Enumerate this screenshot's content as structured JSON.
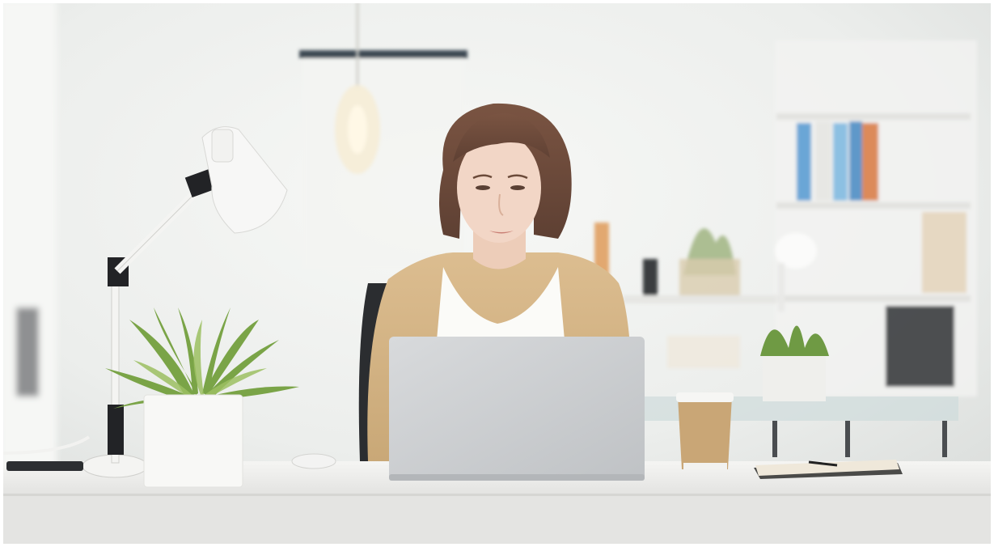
{
  "scene": {
    "kind": "photo",
    "subject": "woman-at-laptop"
  },
  "palette": {
    "wall": "#eef0ee",
    "wall_shadow": "#dfe2df",
    "desk_top": "#f3f3f1",
    "desk_front": "#e8e8e6",
    "laptop": "#cfd1d3",
    "laptop_edge": "#b9bcbf",
    "cardigan": "#d8b98c",
    "top": "#fbfbf8",
    "hair": "#6b4a39",
    "skin": "#f0d3c3",
    "plant": "#7fa64a",
    "pot": "#f7f7f5",
    "cup": "#c9a676",
    "book_blue": "#7fb2d6",
    "book_orange": "#d6875a",
    "notebook": "#4a4a48"
  }
}
